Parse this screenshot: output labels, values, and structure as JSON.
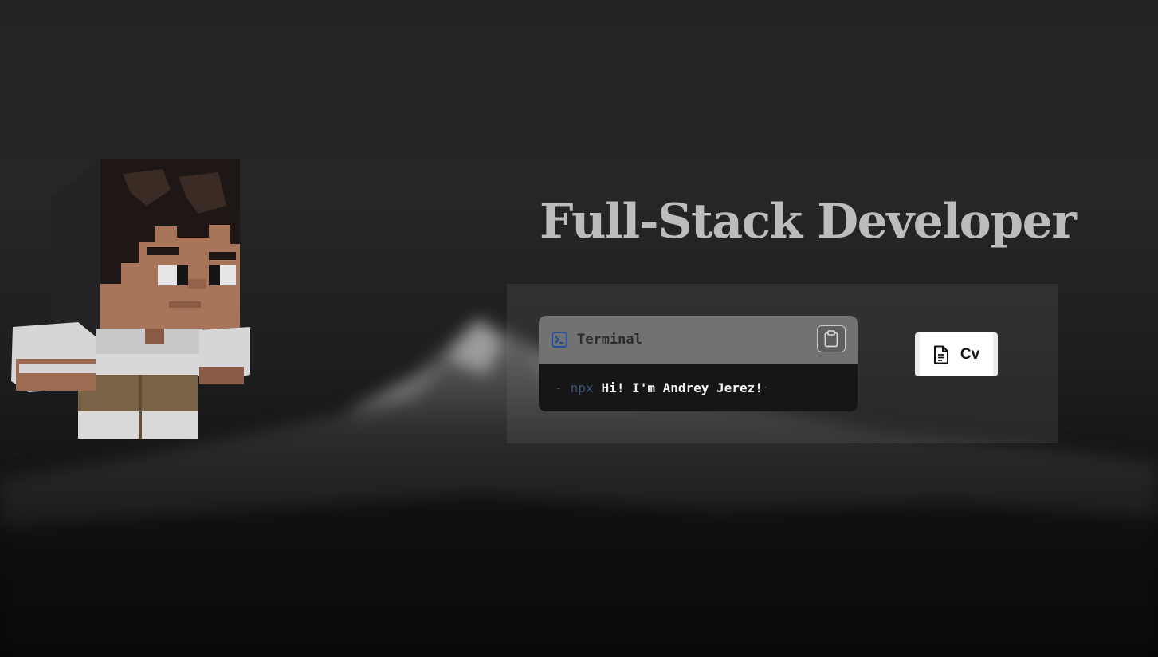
{
  "hero": {
    "title": "Full-Stack Developer"
  },
  "terminal": {
    "header_label": "Terminal",
    "prompt_symbol": "-",
    "command": "npx",
    "message": "Hi! I'm Andrey Jerez!",
    "cursor": "·",
    "icon": "terminal-icon",
    "copy_icon": "clipboard-icon"
  },
  "cv_button": {
    "label": "Cv",
    "icon": "file-text-icon"
  },
  "colors": {
    "title": "#bdbcbc",
    "terminal_header": "#727272",
    "terminal_body": "#161616",
    "terminal_icon": "#1f4fa0"
  }
}
